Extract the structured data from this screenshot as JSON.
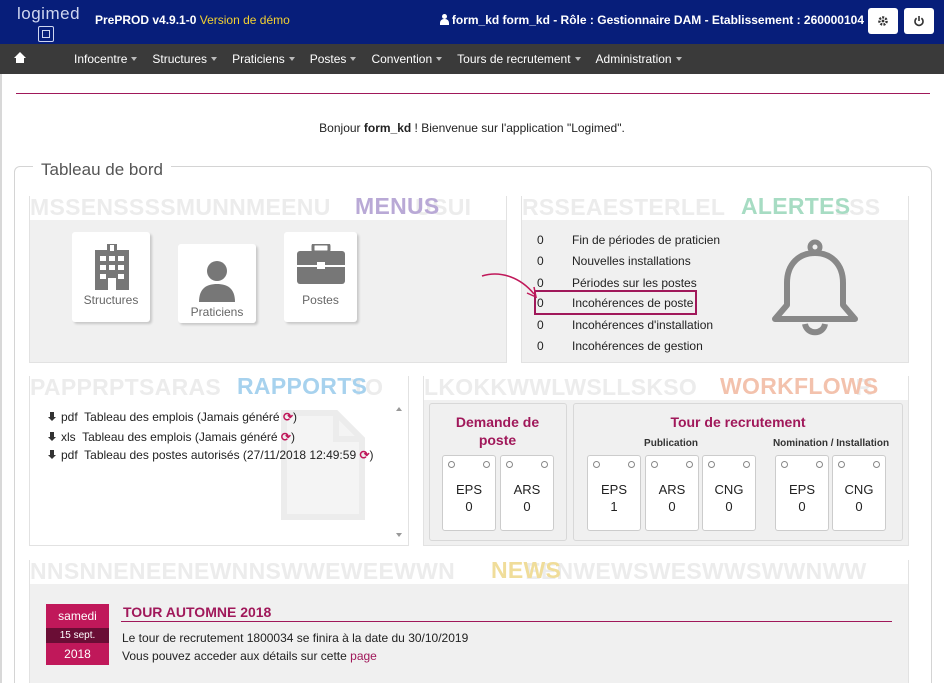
{
  "header": {
    "logo_text": "logimed",
    "app_version": "PrePROD v4.9.1-0",
    "demo_label": "Version de démo",
    "user_info": "form_kd form_kd - Rôle : Gestionnaire DAM - Etablissement : 260000104"
  },
  "nav": {
    "items": [
      {
        "label": "Infocentre"
      },
      {
        "label": "Structures"
      },
      {
        "label": "Praticiens"
      },
      {
        "label": "Postes"
      },
      {
        "label": "Convention"
      },
      {
        "label": "Tours de recrutement"
      },
      {
        "label": "Administration"
      }
    ]
  },
  "welcome": {
    "prefix": "Bonjour ",
    "user": "form_kd",
    "suffix": " ! Bienvenue sur l'application \"Logimed\"."
  },
  "dashboard": {
    "title": "Tableau de bord",
    "menus": {
      "watermark": "MSSENSSSSMUNNMEENU",
      "watermark_after": "USUI",
      "heading": "MENUS",
      "heading_color": "#b9a9d6",
      "tiles": [
        {
          "label": "Structures",
          "icon": "building-icon"
        },
        {
          "label": "Praticiens",
          "icon": "person-icon"
        },
        {
          "label": "Postes",
          "icon": "briefcase-icon"
        }
      ]
    },
    "alertes": {
      "watermark": "RSSEAESTERLEL",
      "watermark_after": "LSS",
      "heading": "ALERTES",
      "heading_color": "#a7dcc3",
      "items": [
        {
          "count": "0",
          "label": "Fin de périodes de praticien"
        },
        {
          "count": "0",
          "label": "Nouvelles installations"
        },
        {
          "count": "0",
          "label": "Périodes sur les postes"
        },
        {
          "count": "0",
          "label": "Incohérences de poste"
        },
        {
          "count": "0",
          "label": "Incohérences d'installation"
        },
        {
          "count": "0",
          "label": "Incohérences de gestion"
        }
      ]
    },
    "rapports": {
      "watermark": "PAPPRPTSARAS",
      "watermark_after": "TO",
      "heading": "RAPPORTS",
      "heading_color": "#a7d2ee",
      "items": [
        {
          "format": "pdf",
          "label": "Tableau des emplois (Jamais généré"
        },
        {
          "format": "xls",
          "label": "Tableau des emplois (Jamais généré"
        },
        {
          "format": "pdf",
          "label": "Tableau des postes autorisés (27/11/2018 12:49:59"
        }
      ]
    },
    "workflows": {
      "watermark": "LKOKKWWLWSLLSKSO",
      "watermark_after": "R",
      "heading": "WORKFLOWS",
      "heading_color": "#f3c2ad",
      "demande": {
        "title": "Demande de poste",
        "cards": [
          {
            "label": "EPS",
            "value": "0"
          },
          {
            "label": "ARS",
            "value": "0"
          }
        ]
      },
      "tour": {
        "title": "Tour de recrutement",
        "publication_label": "Publication",
        "publication_cards": [
          {
            "label": "EPS",
            "value": "1"
          },
          {
            "label": "ARS",
            "value": "0"
          },
          {
            "label": "CNG",
            "value": "0"
          }
        ],
        "nomination_label": "Nomination / Installation",
        "nomination_cards": [
          {
            "label": "EPS",
            "value": "0"
          },
          {
            "label": "CNG",
            "value": "0"
          }
        ]
      }
    },
    "news": {
      "watermark": "NNSNNENEENEWNNSWWEWEEWWN",
      "watermark_after": "EENWEWSWESWWSWWNWW",
      "heading": "NEWS",
      "heading_color": "#f0dd9a",
      "date_day": "samedi",
      "date_short": "15 sept.",
      "date_year": "2018",
      "title": "TOUR AUTOMNE 2018",
      "text": "Le tour de recrutement 1800034 se finira à la date du 30/10/2019",
      "link_prefix": "Vous pouvez acceder aux détails sur cette ",
      "link_label": "page"
    }
  }
}
